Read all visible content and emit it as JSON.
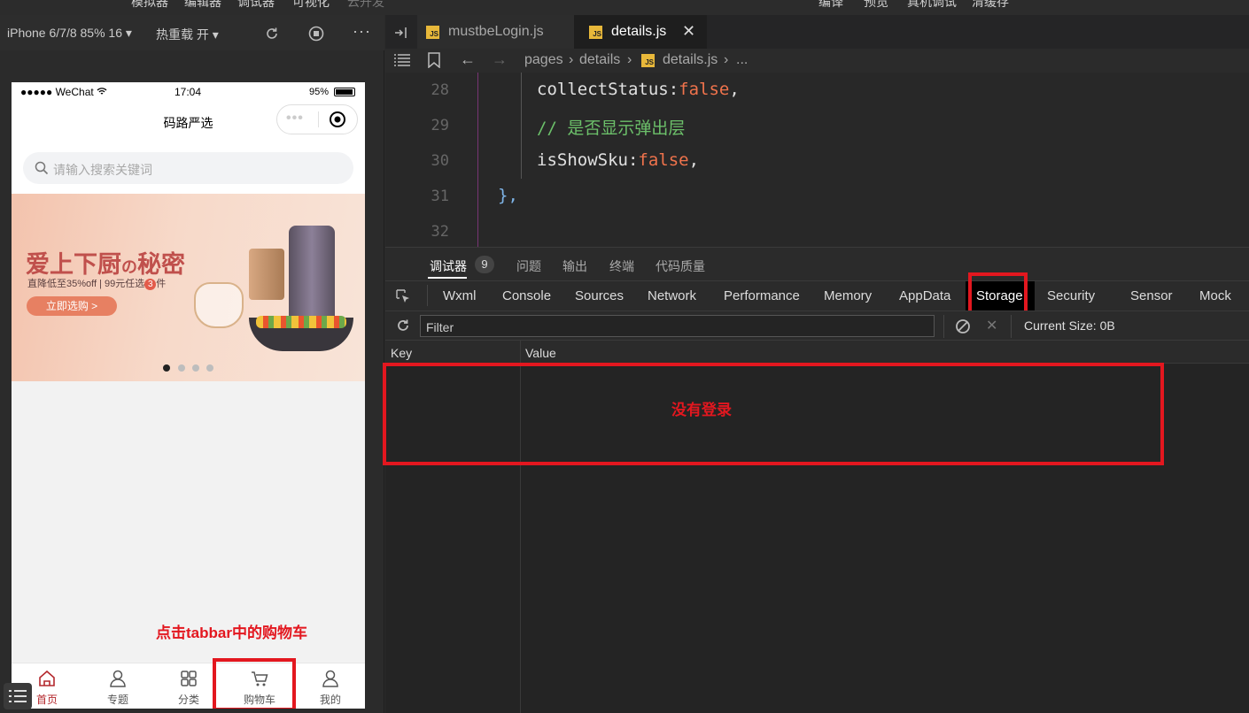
{
  "menubar": {
    "items": [
      "模拟器",
      "编辑器",
      "调试器",
      "可视化",
      "云开发"
    ],
    "right_items": [
      "编译",
      "预览",
      "真机调试",
      "清缓存"
    ]
  },
  "simulator": {
    "device_label": "iPhone 6/7/8 85% 16 ▾",
    "hot_reload_label": "热重载 开 ▾",
    "status": {
      "carrier": "●●●●● WeChat",
      "time": "17:04",
      "battery": "95%"
    },
    "nav_title": "码路严选",
    "search_placeholder": "请输入搜索关键词",
    "banner": {
      "headline_a": "爱上下厨",
      "headline_b": "の",
      "headline_c": "秘密",
      "subline": "直降低至35%off | 99元任选",
      "subline_num": "3",
      "subline_tail": "件",
      "button": "立即选购 >"
    },
    "tabbar": [
      {
        "label": "首页",
        "icon": "home-icon",
        "active": true
      },
      {
        "label": "专题",
        "icon": "topic-icon",
        "active": false
      },
      {
        "label": "分类",
        "icon": "category-icon",
        "active": false
      },
      {
        "label": "购物车",
        "icon": "cart-icon",
        "active": false
      },
      {
        "label": "我的",
        "icon": "user-icon",
        "active": false
      }
    ],
    "annotation": "点击tabbar中的购物车"
  },
  "editor": {
    "tabs": [
      {
        "name": "mustbeLogin.js",
        "active": false
      },
      {
        "name": "details.js",
        "active": true
      }
    ],
    "breadcrumb": [
      "pages",
      "details",
      "details.js",
      "..."
    ],
    "lines": [
      {
        "num": "28",
        "key": "collectStatus",
        "colon": ":",
        "val": "false",
        "tail": ","
      },
      {
        "num": "29",
        "comment": "// 是否显示弹出层"
      },
      {
        "num": "30",
        "key": "isShowSku",
        "colon": ":",
        "val": "false",
        "tail": ","
      },
      {
        "num": "31",
        "brace": "},"
      },
      {
        "num": "32"
      }
    ]
  },
  "devtools": {
    "panel_tabs": [
      {
        "label": "调试器",
        "badge": "9"
      },
      {
        "label": "问题"
      },
      {
        "label": "输出"
      },
      {
        "label": "终端"
      },
      {
        "label": "代码质量"
      }
    ],
    "tabs": [
      "Wxml",
      "Console",
      "Sources",
      "Network",
      "Performance",
      "Memory",
      "AppData",
      "Storage",
      "Security",
      "Sensor",
      "Mock"
    ],
    "active_tab": "Storage",
    "filter_placeholder": "Filter",
    "current_size": "Current Size: 0B",
    "columns": [
      "Key",
      "Value"
    ],
    "annotation": "没有登录"
  },
  "colors": {
    "annotation_red": "#e3171f",
    "keyword_orange": "#f0734c",
    "comment_green": "#6cc06a",
    "brand_red": "#b4282d"
  }
}
